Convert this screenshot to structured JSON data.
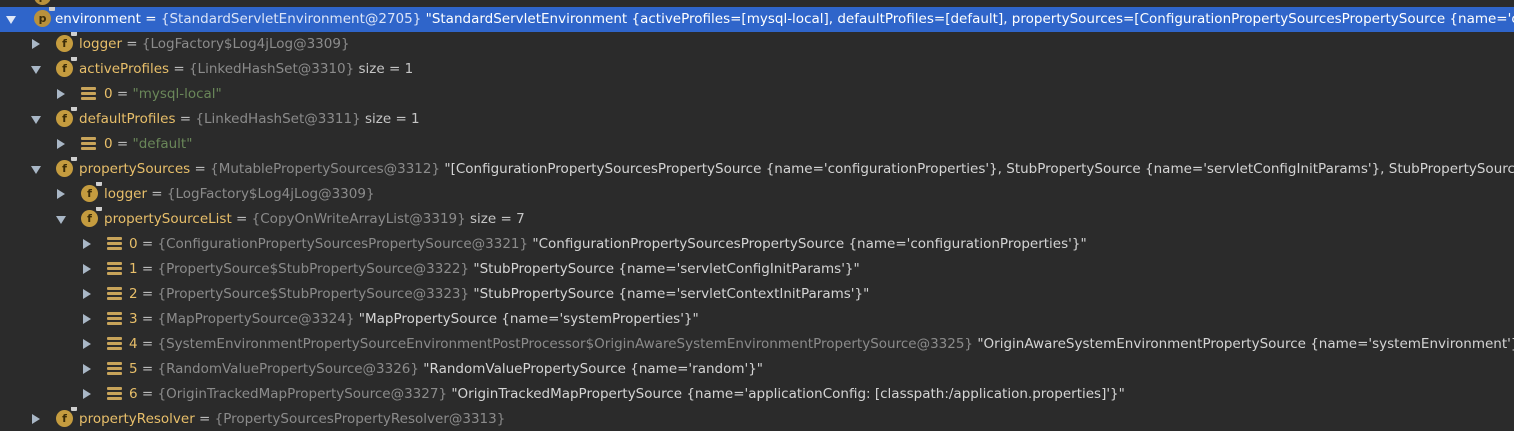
{
  "tree": {
    "partial_row": {
      "text": "p  environment = {StandardServletEnvironment@2705} ..."
    },
    "rows": [
      {
        "key": "environment",
        "eq": " = ",
        "ref": "{StandardServletEnvironment@2705}",
        "value": " \"StandardServletEnvironment {activeProfiles=[mysql-local], defaultProfiles=[default], propertySources=[ConfigurationPropertySourcesPropertySource {name='configurat",
        "icon": "p",
        "expanded": true
      },
      {
        "key": "logger",
        "eq": " = ",
        "ref": "{LogFactory$Log4jLog@3309}",
        "value": "",
        "icon": "f",
        "expanded": false
      },
      {
        "key": "activeProfiles",
        "eq": " = ",
        "ref": "{LinkedHashSet@3310}",
        "value": "  size = 1",
        "icon": "f",
        "expanded": true
      },
      {
        "key": "0",
        "eq": " = ",
        "ref": "",
        "value": "\"mysql-local\"",
        "icon": "array",
        "expanded": false
      },
      {
        "key": "defaultProfiles",
        "eq": " = ",
        "ref": "{LinkedHashSet@3311}",
        "value": "  size = 1",
        "icon": "f",
        "expanded": true
      },
      {
        "key": "0",
        "eq": " = ",
        "ref": "",
        "value": "\"default\"",
        "icon": "array",
        "expanded": false
      },
      {
        "key": "propertySources",
        "eq": " = ",
        "ref": "{MutablePropertySources@3312}",
        "value": " \"[ConfigurationPropertySourcesPropertySource {name='configurationProperties'}, StubPropertySource {name='servletConfigInitParams'}, StubPropertySource {name=",
        "icon": "f",
        "expanded": true
      },
      {
        "key": "logger",
        "eq": " = ",
        "ref": "{LogFactory$Log4jLog@3309}",
        "value": "",
        "icon": "f",
        "expanded": false
      },
      {
        "key": "propertySourceList",
        "eq": " = ",
        "ref": "{CopyOnWriteArrayList@3319}",
        "value": "  size = 7",
        "icon": "f",
        "expanded": true
      },
      {
        "key": "0",
        "eq": " = ",
        "ref": "{ConfigurationPropertySourcesPropertySource@3321}",
        "value": " \"ConfigurationPropertySourcesPropertySource {name='configurationProperties'}\"",
        "icon": "array",
        "expanded": false
      },
      {
        "key": "1",
        "eq": " = ",
        "ref": "{PropertySource$StubPropertySource@3322}",
        "value": " \"StubPropertySource {name='servletConfigInitParams'}\"",
        "icon": "array",
        "expanded": false
      },
      {
        "key": "2",
        "eq": " = ",
        "ref": "{PropertySource$StubPropertySource@3323}",
        "value": " \"StubPropertySource {name='servletContextInitParams'}\"",
        "icon": "array",
        "expanded": false
      },
      {
        "key": "3",
        "eq": " = ",
        "ref": "{MapPropertySource@3324}",
        "value": " \"MapPropertySource {name='systemProperties'}\"",
        "icon": "array",
        "expanded": false
      },
      {
        "key": "4",
        "eq": " = ",
        "ref": "{SystemEnvironmentPropertySourceEnvironmentPostProcessor$OriginAwareSystemEnvironmentPropertySource@3325}",
        "value": " \"OriginAwareSystemEnvironmentPropertySource {name='systemEnvironment'}\"",
        "icon": "array",
        "expanded": false
      },
      {
        "key": "5",
        "eq": " = ",
        "ref": "{RandomValuePropertySource@3326}",
        "value": " \"RandomValuePropertySource {name='random'}\"",
        "icon": "array",
        "expanded": false
      },
      {
        "key": "6",
        "eq": " = ",
        "ref": "{OriginTrackedMapPropertySource@3327}",
        "value": " \"OriginTrackedMapPropertySource {name='applicationConfig: [classpath:/application.properties]'}\"",
        "icon": "array",
        "expanded": false
      },
      {
        "key": "propertyResolver",
        "eq": " = ",
        "ref": "{PropertySourcesPropertyResolver@3313}",
        "value": "",
        "icon": "f",
        "expanded": false
      }
    ]
  },
  "colors": {
    "background": "#2b2b2b",
    "selection": "#2f65ca",
    "key": "#e8bf6a",
    "reference": "#8b8b8b",
    "string": "#6a8759",
    "icon": "#c59c3f"
  },
  "icons": {
    "field": "field-icon",
    "property": "property-icon",
    "array": "array-element-icon",
    "expand": "chevron-right-icon",
    "collapse": "chevron-down-icon"
  }
}
